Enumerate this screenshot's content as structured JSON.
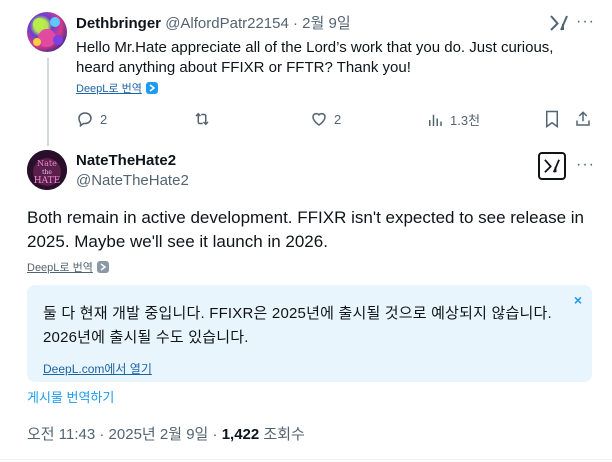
{
  "reply": {
    "name": "Dethbringer",
    "handle": "@AlfordPatr22154",
    "separator": "·",
    "date": "2월 9일",
    "body": "Hello Mr.Hate appreciate all of the Lord’s work that you do. Just curious, heard anything about FFIXR or FFTR? Thank you!",
    "translate_label": "DeepL로 번역",
    "actions": {
      "replies": "2",
      "reposts": "",
      "likes": "2",
      "views": "1.3천"
    }
  },
  "main": {
    "name": "NateTheHate2",
    "handle": "@NateTheHate2",
    "text": "Both remain in active development. FFIXR isn't expected to see release in 2025. Maybe we'll see it launch in 2026.",
    "translate_label": "DeepL로 번역",
    "translation": {
      "text": "둘 다 현재 개발 중입니다. FFIXR은 2025년에 출시될 것으로 예상되지 않습니다. 2026년에 출시될 수도 있습니다.",
      "link": "DeepL.com에서 열기",
      "close": "×"
    },
    "post_translate": "게시물 번역하기",
    "meta": {
      "time": "오전 11:43",
      "separator": "·",
      "date": "2025년 2월 9일",
      "views_count": "1,422",
      "views_label": "조회수"
    }
  },
  "colors": {
    "accent": "#1d9bf0",
    "secondary_text": "#536471",
    "translation_bg": "#e8f5fd"
  }
}
